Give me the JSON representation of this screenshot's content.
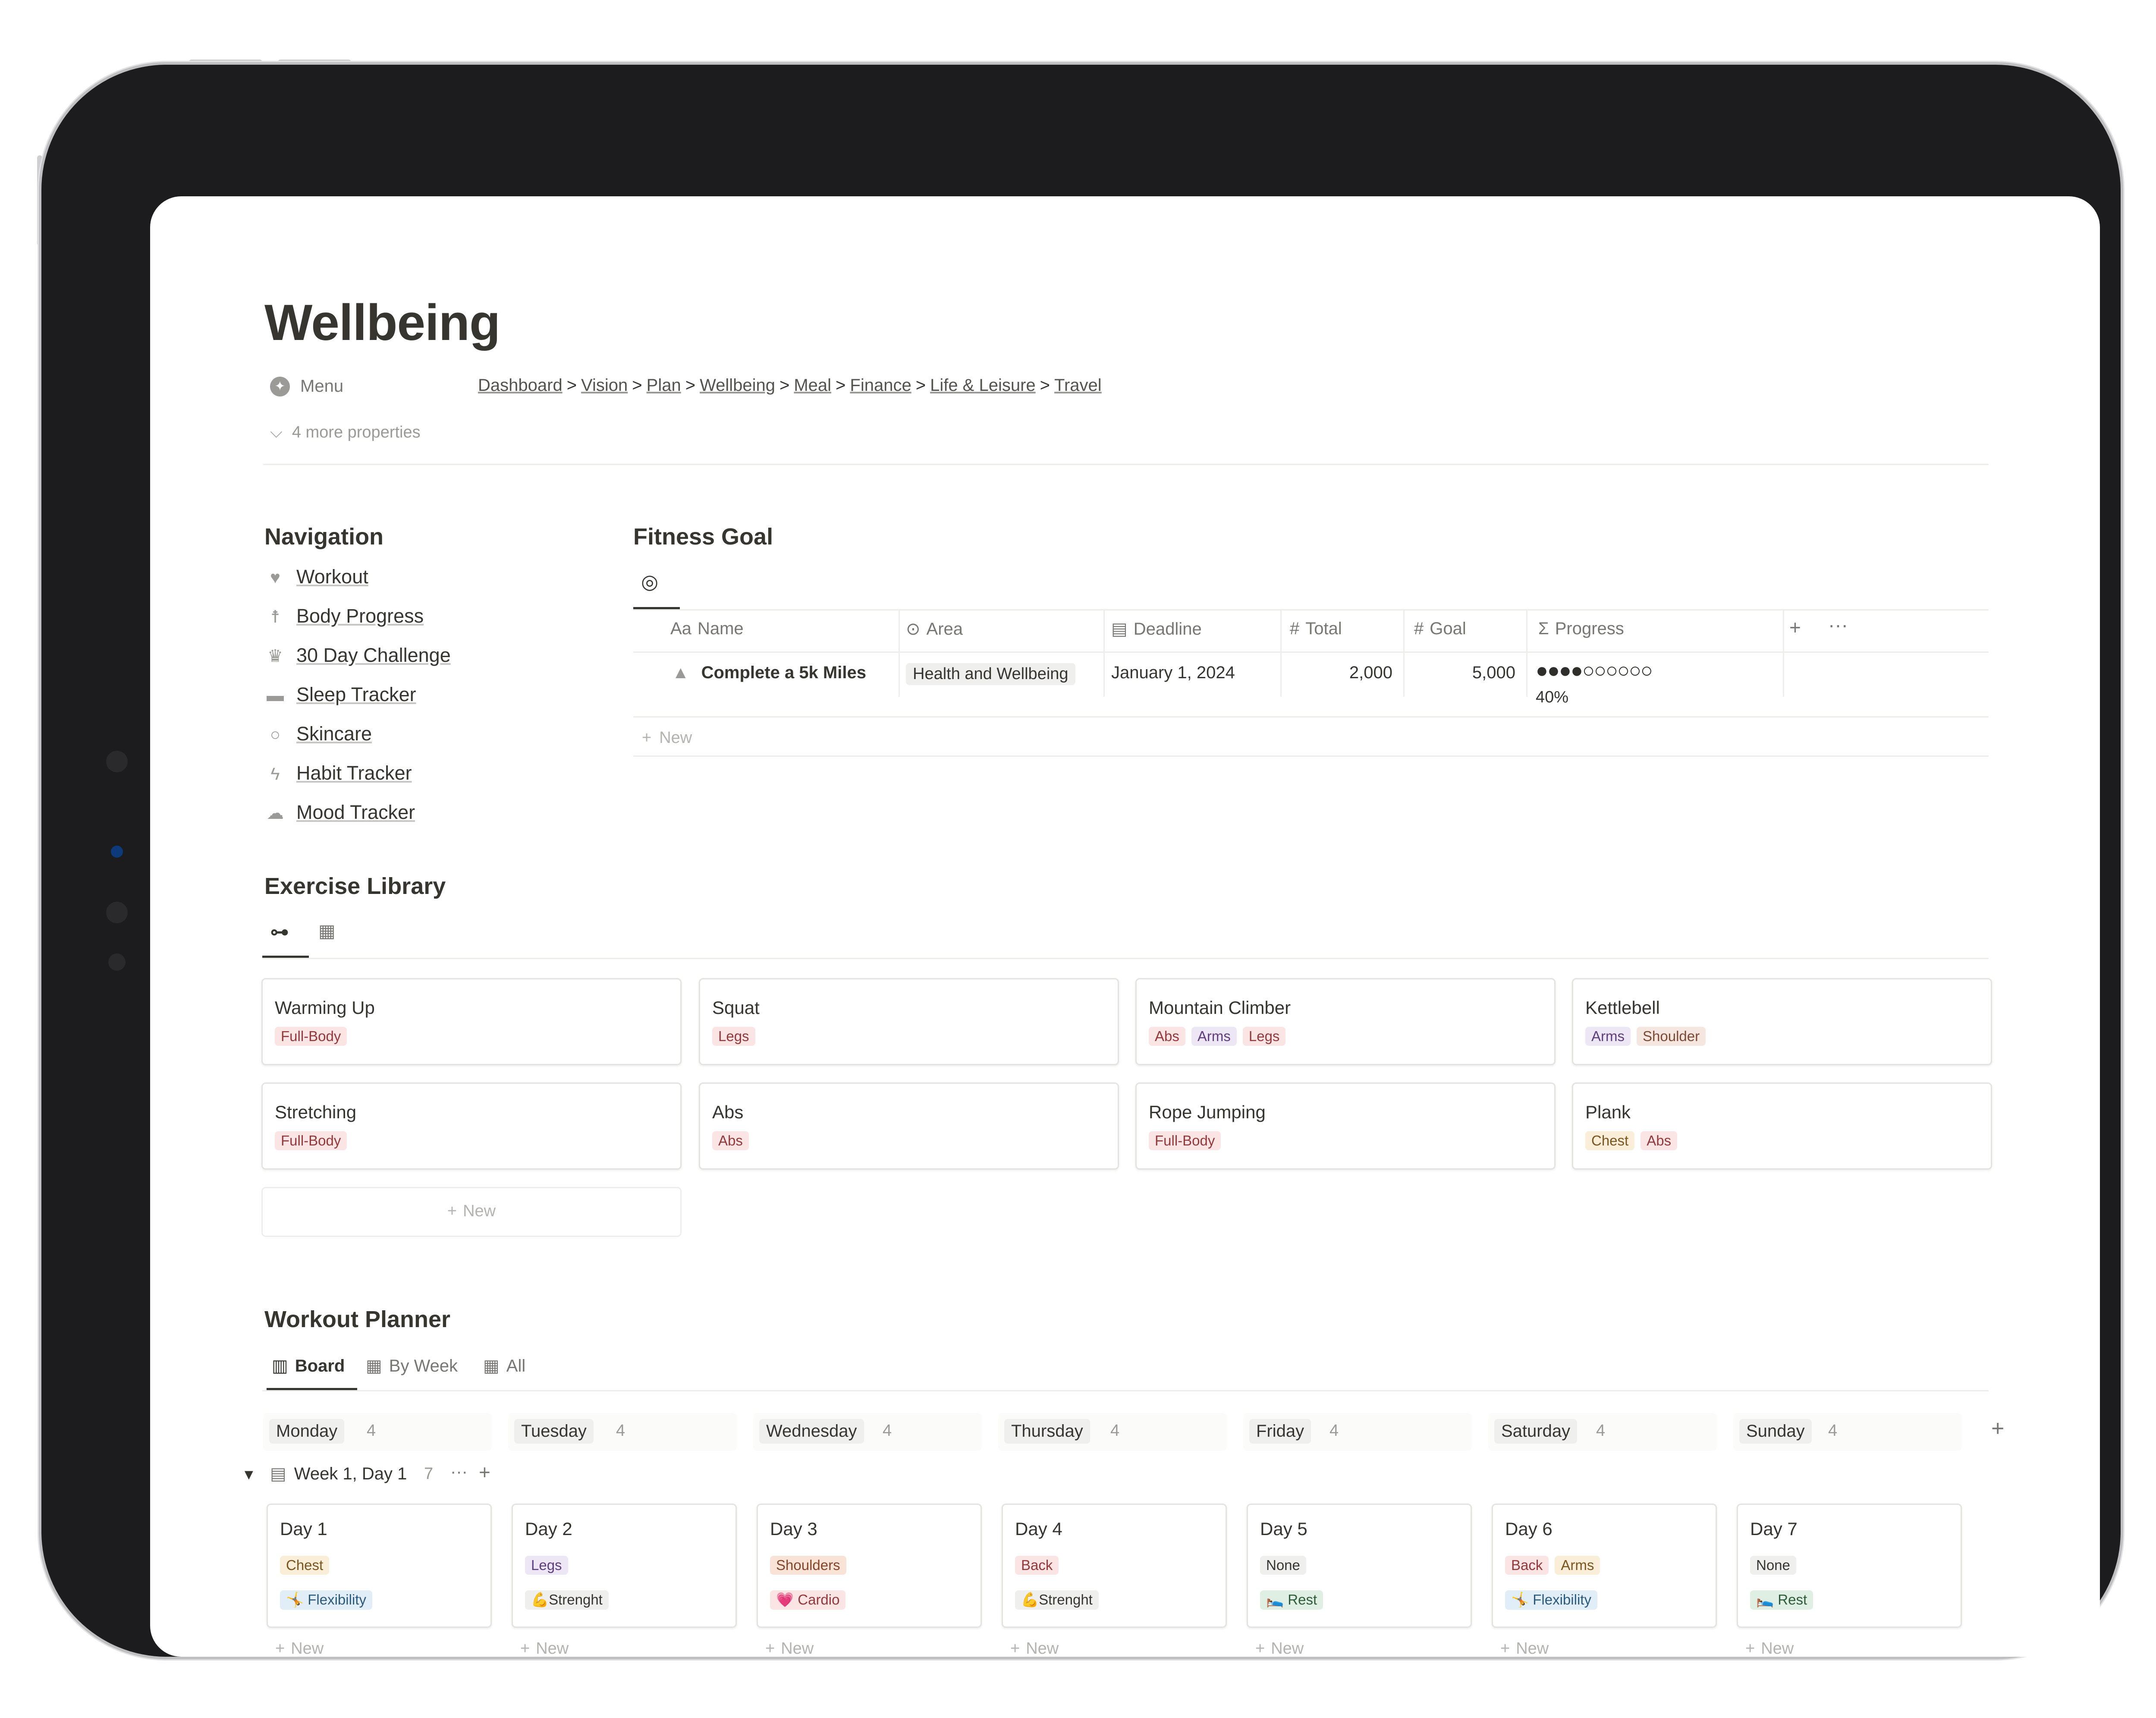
{
  "page": {
    "title": "Wellbeing"
  },
  "properties": {
    "menu_label": "Menu",
    "breadcrumbs": [
      "Dashboard",
      "Vision",
      "Plan",
      "Wellbeing",
      "Meal",
      "Finance",
      "Life & Leisure",
      "Travel"
    ],
    "more": "4 more properties"
  },
  "navigation": {
    "title": "Navigation",
    "items": [
      {
        "label": "Workout",
        "icon": "heartbeat-icon"
      },
      {
        "label": "Body Progress",
        "icon": "figure-icon"
      },
      {
        "label": "30 Day Challenge",
        "icon": "trophy-icon"
      },
      {
        "label": "Sleep Tracker",
        "icon": "bed-icon"
      },
      {
        "label": "Skincare",
        "icon": "mirror-icon"
      },
      {
        "label": "Habit Tracker",
        "icon": "bolt-icon"
      },
      {
        "label": "Mood Tracker",
        "icon": "weather-icon"
      }
    ]
  },
  "fitness": {
    "title": "Fitness Goal",
    "columns": {
      "name": "Name",
      "area": "Area",
      "deadline": "Deadline",
      "total": "Total",
      "goal": "Goal",
      "progress": "Progress"
    },
    "row": {
      "name": "Complete a 5k Miles",
      "area": "Health and Wellbeing",
      "deadline": "January 1, 2024",
      "total": "2,000",
      "goal": "5,000",
      "progress_dots": "●●●●○○○○○○",
      "progress_label": "40%",
      "progress": 0.4
    },
    "new_label": "New"
  },
  "library": {
    "title": "Exercise Library",
    "cards": [
      {
        "name": "Warming Up",
        "tags": [
          "Full-Body"
        ]
      },
      {
        "name": "Squat",
        "tags": [
          "Legs"
        ]
      },
      {
        "name": "Mountain Climber",
        "tags": [
          "Abs",
          "Arms",
          "Legs"
        ]
      },
      {
        "name": "Kettlebell",
        "tags": [
          "Arms",
          "Shoulder"
        ]
      },
      {
        "name": "Stretching",
        "tags": [
          "Full-Body"
        ]
      },
      {
        "name": "Abs",
        "tags": [
          "Abs"
        ]
      },
      {
        "name": "Rope Jumping",
        "tags": [
          "Full-Body"
        ]
      },
      {
        "name": "Plank",
        "tags": [
          "Chest",
          "Abs"
        ]
      }
    ],
    "new_label": "New"
  },
  "planner": {
    "title": "Workout Planner",
    "tabs": [
      "Board",
      "By Week",
      "All"
    ],
    "columns": [
      {
        "label": "Monday",
        "count": "4"
      },
      {
        "label": "Tuesday",
        "count": "4"
      },
      {
        "label": "Wednesday",
        "count": "4"
      },
      {
        "label": "Thursday",
        "count": "4"
      },
      {
        "label": "Friday",
        "count": "4"
      },
      {
        "label": "Saturday",
        "count": "4"
      },
      {
        "label": "Sunday",
        "count": "4"
      }
    ],
    "group": {
      "label": "Week 1, Day 1",
      "count": "7"
    },
    "cards": [
      {
        "name": "Day 1",
        "tag1": "Chest",
        "tag2": "🤸 Flexibility"
      },
      {
        "name": "Day 2",
        "tag1": "Legs",
        "tag2": "💪Strenght"
      },
      {
        "name": "Day 3",
        "tag1": "Shoulders",
        "tag2": "💗 Cardio"
      },
      {
        "name": "Day 4",
        "tag1": "Back",
        "tag2": "💪Strenght"
      },
      {
        "name": "Day 5",
        "tag1": "None",
        "tag2": "🛌 Rest"
      },
      {
        "name": "Day 6",
        "tag1": "Back",
        "tag1b": "Arms",
        "tag2": "🤸 Flexibility"
      },
      {
        "name": "Day 7",
        "tag1": "None",
        "tag2": "🛌 Rest"
      }
    ],
    "new_label": "New"
  }
}
